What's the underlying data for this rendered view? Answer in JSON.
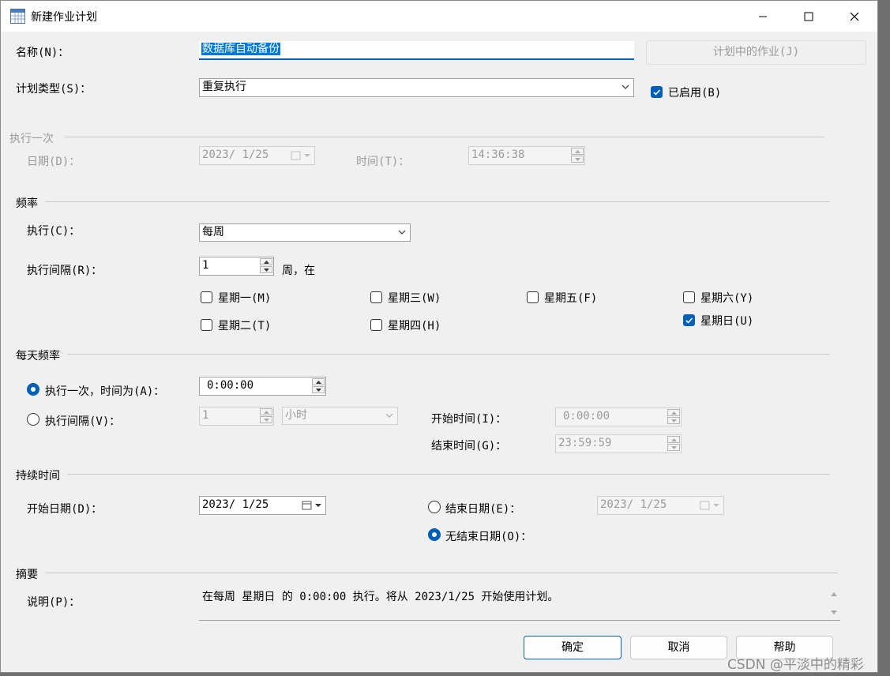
{
  "window": {
    "title": "新建作业计划",
    "icons": {
      "app": "calendar-grid-icon",
      "minimize": "minimize-icon",
      "maximize": "maximize-icon",
      "close": "close-icon"
    }
  },
  "form": {
    "name_label": "名称(N)：",
    "name_value": "数据库自动备份",
    "jobs_button": "计划中的作业(J)",
    "type_label": "计划类型(S)：",
    "type_value": "重复执行",
    "enabled_label": "已启用(B)",
    "enabled_checked": true
  },
  "once": {
    "section": "执行一次",
    "date_label": "日期(D)：",
    "date_value": "2023/ 1/25",
    "time_label": "时间(T)：",
    "time_value": "14:36:38"
  },
  "frequency": {
    "section": "频率",
    "run_label": "执行(C)：",
    "run_value": "每周",
    "interval_label": "执行间隔(R)：",
    "interval_value": "1",
    "interval_suffix": "周，在",
    "days": [
      {
        "label": "星期一(M)",
        "checked": false
      },
      {
        "label": "星期三(W)",
        "checked": false
      },
      {
        "label": "星期五(F)",
        "checked": false
      },
      {
        "label": "星期六(Y)",
        "checked": false
      },
      {
        "label": "星期二(T)",
        "checked": false
      },
      {
        "label": "星期四(H)",
        "checked": false
      },
      {
        "label": "星期日(U)",
        "checked": true
      }
    ]
  },
  "daily": {
    "section": "每天频率",
    "once_label": "执行一次，时间为(A)：",
    "once_value": "0:00:00",
    "interval_label": "执行间隔(V)：",
    "interval_value": "1",
    "interval_unit": "小时",
    "start_label": "开始时间(I)：",
    "start_value": "0:00:00",
    "end_label": "结束时间(G)：",
    "end_value": "23:59:59",
    "selected": "once"
  },
  "duration": {
    "section": "持续时间",
    "start_label": "开始日期(D)：",
    "start_value": "2023/ 1/25",
    "end_label": "结束日期(E)：",
    "end_value": "2023/ 1/25",
    "no_end_label": "无结束日期(O)：",
    "selected": "no_end"
  },
  "summary": {
    "section": "摘要",
    "desc_label": "说明(P)：",
    "desc_value": "在每周 星期日 的 0:00:00 执行。将从 2023/1/25 开始使用计划。"
  },
  "buttons": {
    "ok": "确定",
    "cancel": "取消",
    "help": "帮助"
  },
  "watermark": "CSDN @平淡中的精彩"
}
